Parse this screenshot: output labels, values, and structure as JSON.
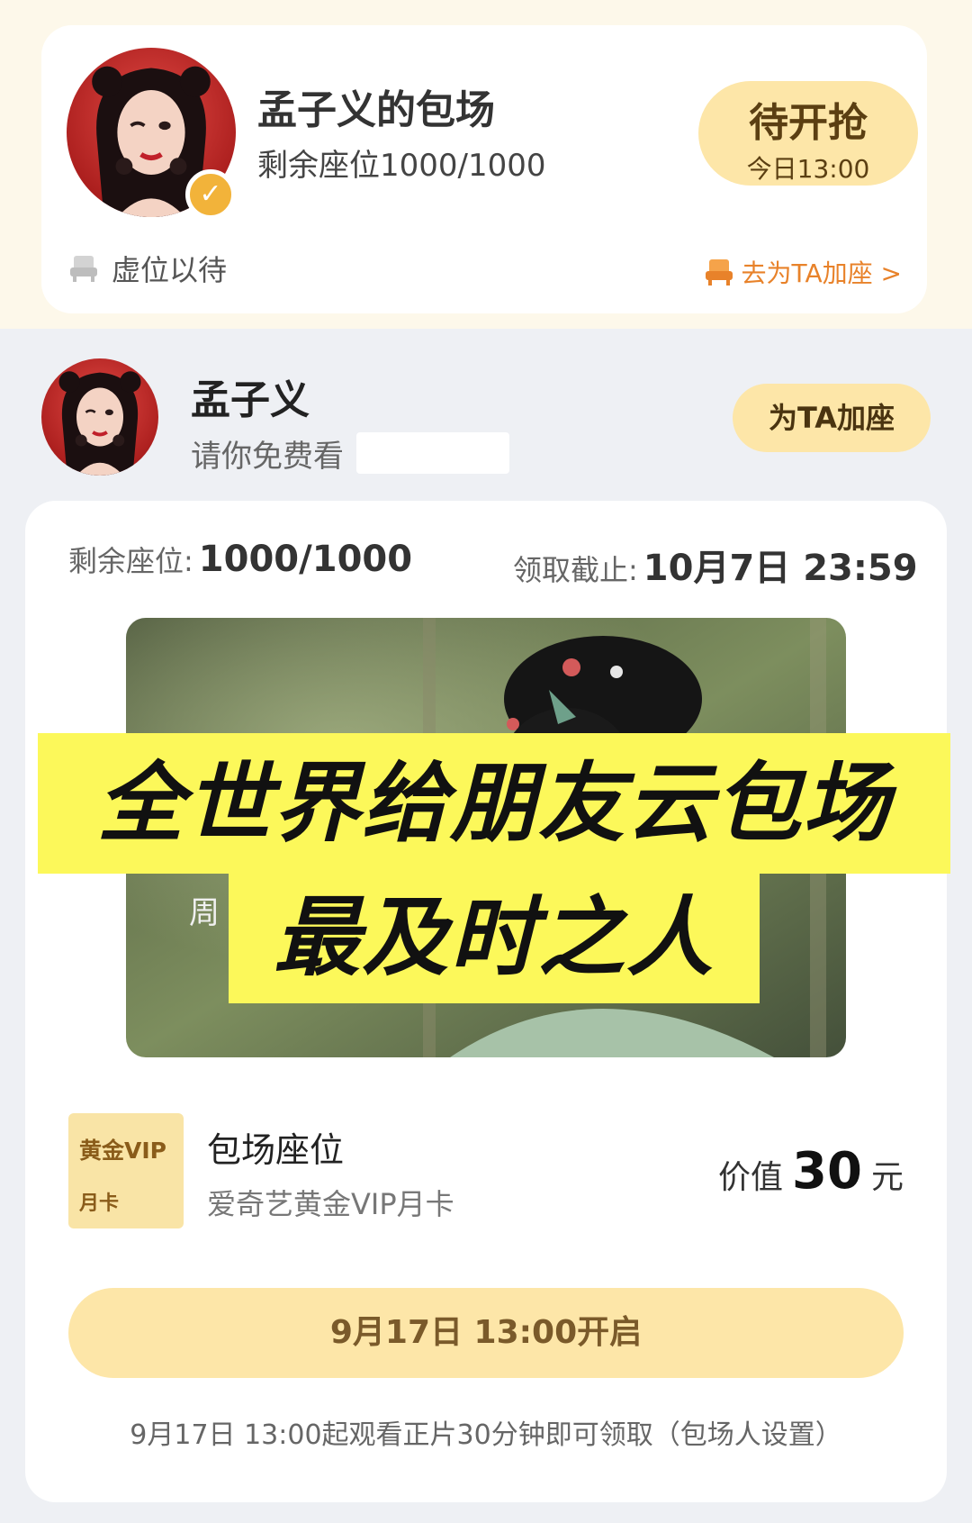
{
  "colors": {
    "top_band": "#fdf8ea",
    "pill_yellow": "#fde6a8",
    "link_orange": "#e8822a",
    "caption_yellow": "#fcf85a",
    "page_bg": "#eef0f4"
  },
  "top_card": {
    "title": "孟子义的包场",
    "seats": "剩余座位1000/1000",
    "status": {
      "main": "待开抢",
      "time": "今日13:00"
    },
    "reserved_label": "虚位以待",
    "reserved_icon": "seat-icon",
    "add_seat_link": "去为TA加座 >",
    "add_seat_icon": "seat-icon",
    "verified_icon": "checkmark-badge-icon"
  },
  "host": {
    "name": "孟子义",
    "invite": "请你免费看",
    "add_seat_button": "为TA加座"
  },
  "main_card": {
    "remaining_label": "剩余座位:",
    "remaining_value": "1000/1000",
    "deadline_label": "领取截止:",
    "deadline_value": "10月7日 23:59",
    "poster_char": "周",
    "caption_line1": "全世界给朋友云包场",
    "caption_line2": "最及时之人",
    "vip_card": {
      "top": "黄金VIP",
      "bottom": "月卡"
    },
    "seat_title": "包场座位",
    "seat_desc": "爱奇艺黄金VIP月卡",
    "value_label": "价值",
    "value_amount": "30",
    "value_unit": "元",
    "open_button": "9月17日 13:00开启",
    "footnote": "9月17日 13:00起观看正片30分钟即可领取（包场人设置）"
  }
}
